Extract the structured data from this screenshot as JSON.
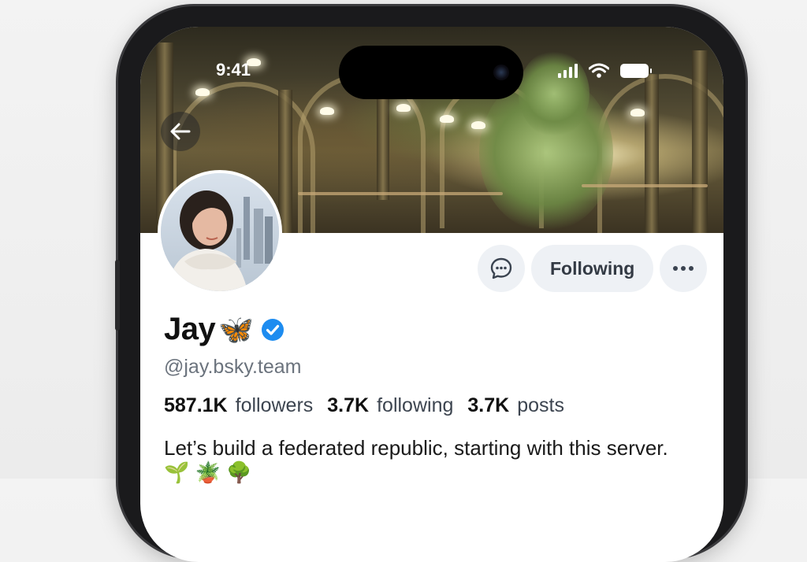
{
  "status_bar": {
    "time": "9:41"
  },
  "profile": {
    "display_name": "Jay",
    "name_emoji": "🦋",
    "handle": "@jay.bsky.team",
    "verified": true,
    "stats": [
      {
        "value": "587.1K",
        "label": "followers"
      },
      {
        "value": "3.7K",
        "label": "following"
      },
      {
        "value": "3.7K",
        "label": "posts"
      }
    ],
    "bio": "Let’s build a federated republic, starting with this server. 🌱 🪴 🌳"
  },
  "actions": {
    "message_icon": "chat-bubble-icon",
    "follow_button_label": "Following",
    "more_icon": "ellipsis-icon"
  },
  "icons": {
    "back": "arrow-left-icon",
    "verified": "verified-check-icon",
    "signal": "cellular-signal-icon",
    "wifi": "wifi-icon",
    "battery": "battery-icon"
  },
  "colors": {
    "verified_blue": "#1d8cf0",
    "button_bg": "#eef1f5",
    "handle_gray": "#6b737d",
    "phone_frame": "#1a1a1c"
  }
}
